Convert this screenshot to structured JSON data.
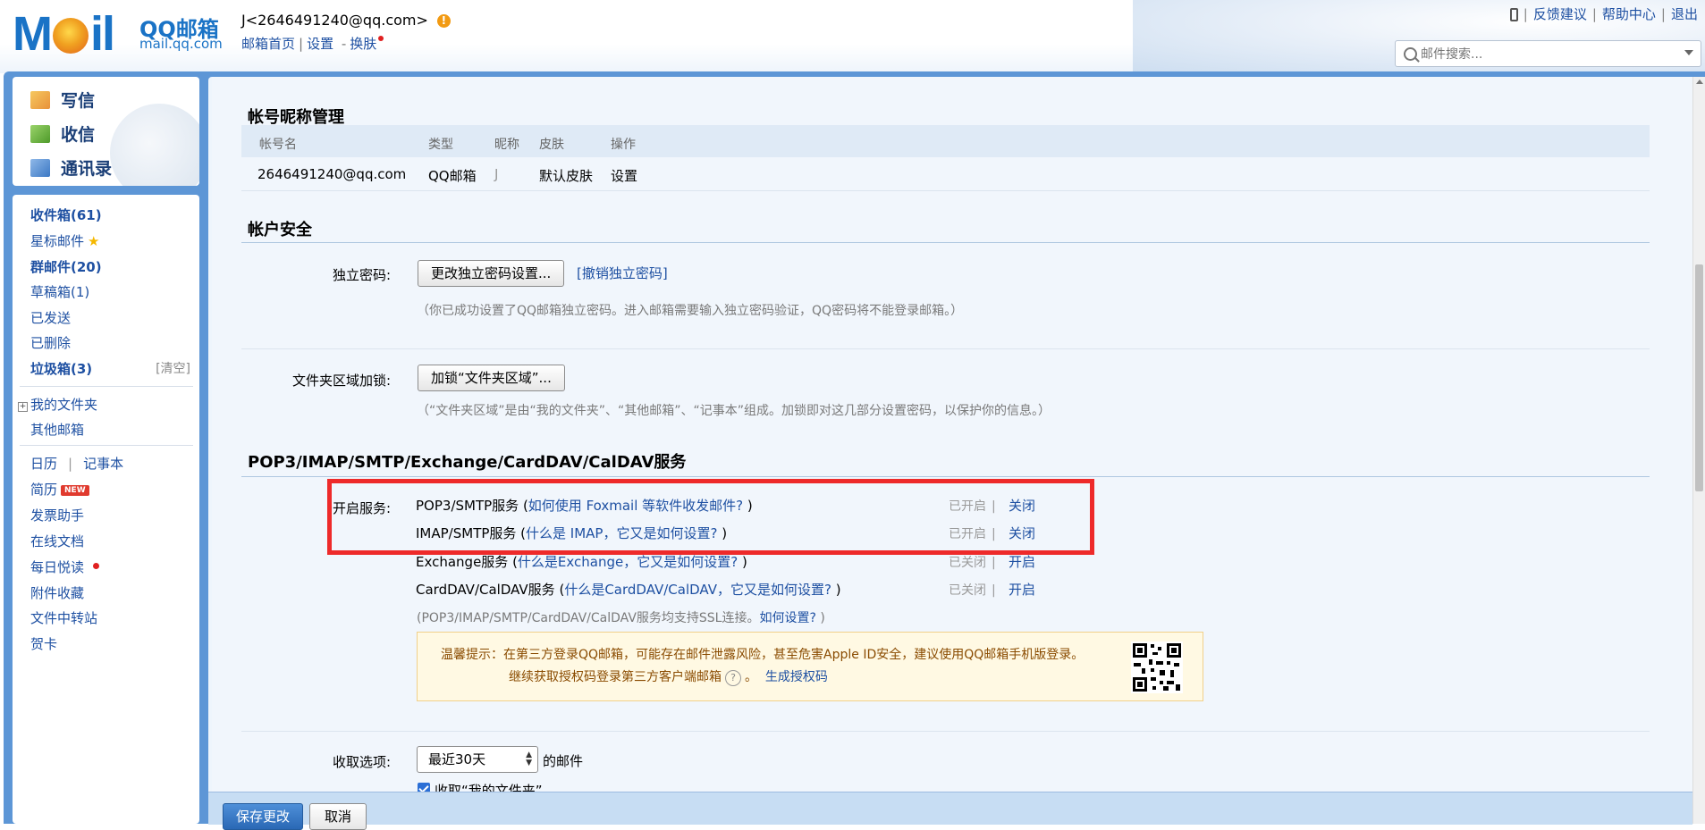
{
  "header": {
    "logo_text": "MOIL",
    "logo_title": "QQ邮箱",
    "logo_domain": "mail.qq.com",
    "user_display": "J<2646491240@qq.com>",
    "nav": {
      "home": "邮箱首页",
      "settings": "设置",
      "dash": "-",
      "skin": "换肤"
    },
    "top_links": {
      "feedback": "反馈建议",
      "help": "帮助中心",
      "logout": "退出"
    },
    "search_placeholder": "邮件搜索..."
  },
  "sidebar": {
    "actions": {
      "compose": "写信",
      "receive": "收信",
      "contacts": "通讯录"
    },
    "folders": {
      "inbox": "收件箱(61)",
      "starred": "星标邮件",
      "groups": "群邮件(20)",
      "drafts": "草稿箱(1)",
      "sent": "已发送",
      "deleted": "已删除",
      "spam": "垃圾箱(3)",
      "spam_clear": "[清空]",
      "my_folders": "我的文件夹",
      "other_mail": "其他邮箱"
    },
    "apps": {
      "calendar": "日历",
      "calendar_sep": "|",
      "notes": "记事本",
      "resume": "简历",
      "new_badge": "NEW",
      "invoice": "发票助手",
      "docs": "在线文档",
      "daily": "每日悦读",
      "attachments": "附件收藏",
      "transfer": "文件中转站",
      "cards": "贺卡"
    }
  },
  "account_section": {
    "title": "帐号昵称管理",
    "columns": [
      "帐号名",
      "类型",
      "昵称",
      "皮肤",
      "操作"
    ],
    "row": {
      "account": "2646491240@qq.com",
      "type": "QQ邮箱",
      "nickname": "J",
      "skin": "默认皮肤",
      "action": "设置"
    }
  },
  "security_section": {
    "title": "帐户安全",
    "password_label": "独立密码:",
    "password_button": "更改独立密码设置...",
    "password_cancel_link": "[撤销独立密码]",
    "password_hint": "（你已成功设置了QQ邮箱独立密码。进入邮箱需要输入独立密码验证，QQ密码将不能登录邮箱。）",
    "folder_lock_label": "文件夹区域加锁:",
    "folder_lock_button": "加锁“文件夹区域”...",
    "folder_lock_hint": "（“文件夹区域”是由“我的文件夹”、“其他邮箱”、“记事本”组成。加锁即对这几部分设置密码，以保护你的信息。）"
  },
  "pop_section": {
    "title": "POP3/IMAP/SMTP/Exchange/CardDAV/CalDAV服务",
    "enable_label": "开启服务:",
    "services": [
      {
        "name": "POP3/SMTP服务",
        "open_paren": " (",
        "link": "如何使用 Foxmail 等软件收发邮件?",
        "close_paren": " )",
        "status": "已开启",
        "toggle": "关闭"
      },
      {
        "name": "IMAP/SMTP服务",
        "open_paren": " (",
        "link": "什么是 IMAP，它又是如何设置?",
        "close_paren": " )",
        "status": "已开启",
        "toggle": "关闭"
      },
      {
        "name": "Exchange服务",
        "open_paren": " (",
        "link": "什么是Exchange，它又是如何设置?",
        "close_paren": " )",
        "status": "已关闭",
        "toggle": "开启"
      },
      {
        "name": "CardDAV/CalDAV服务",
        "open_paren": " (",
        "link": "什么是CardDAV/CalDAV，它又是如何设置?",
        "close_paren": " )",
        "status": "已关闭",
        "toggle": "开启"
      }
    ],
    "status_sep": "|",
    "ssl_hint_pre": "(POP3/IMAP/SMTP/CardDAV/CalDAV服务均支持SSL连接。",
    "ssl_hint_link": "如何设置?",
    "ssl_hint_post": " )",
    "tip_line1": "温馨提示：在第三方登录QQ邮箱，可能存在邮件泄露风险，甚至危害Apple ID安全，建议使用QQ邮箱手机版登录。",
    "tip_line2_pre": "继续获取授权码登录第三方客户端邮箱",
    "tip_help": "?",
    "tip_line2_dot": "。",
    "tip_link": "生成授权码",
    "fetch_label": "收取选项:",
    "fetch_select": "最近30天",
    "fetch_suffix": "的邮件",
    "fetch_checkbox_label": "收取“我的文件夹”"
  },
  "footer": {
    "save": "保存更改",
    "cancel": "取消"
  },
  "colors": {
    "accent": "#1e50a2",
    "frame": "#5d96d6",
    "highlight": "#ee2a2a",
    "save_button": "#2a68b5"
  }
}
